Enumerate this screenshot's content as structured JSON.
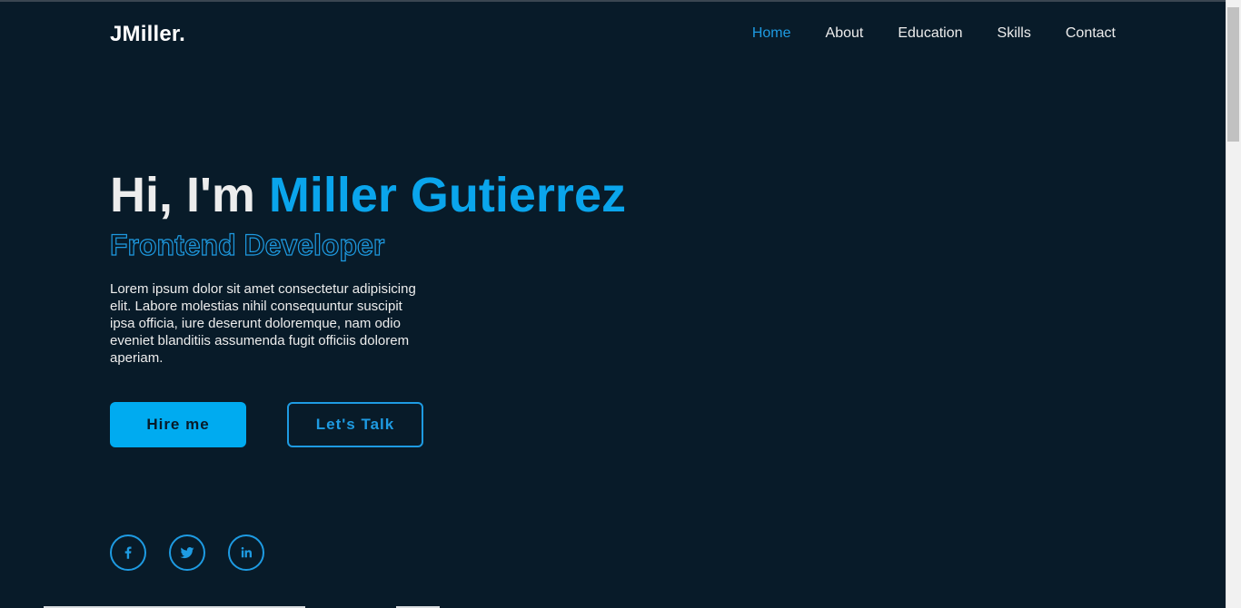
{
  "header": {
    "logo": "JMiller.",
    "nav": [
      {
        "label": "Home",
        "active": true
      },
      {
        "label": "About",
        "active": false
      },
      {
        "label": "Education",
        "active": false
      },
      {
        "label": "Skills",
        "active": false
      },
      {
        "label": "Contact",
        "active": false
      }
    ]
  },
  "hero": {
    "greeting": "Hi, I'm ",
    "name": "Miller Gutierrez",
    "role": "Frontend Developer",
    "description": "Lorem ipsum dolor sit amet consectetur adipisicing elit. Labore molestias nihil consequuntur suscipit ipsa officia, iure deserunt doloremque, nam odio eveniet blanditiis assumenda fugit officiis dolorem aperiam.",
    "buttons": {
      "hire": "Hire me",
      "talk": "Let's Talk"
    }
  },
  "social": [
    "facebook-icon",
    "twitter-icon",
    "linkedin-icon"
  ],
  "colors": {
    "background": "#081b29",
    "accent": "#00abf0",
    "text": "#ededed"
  }
}
